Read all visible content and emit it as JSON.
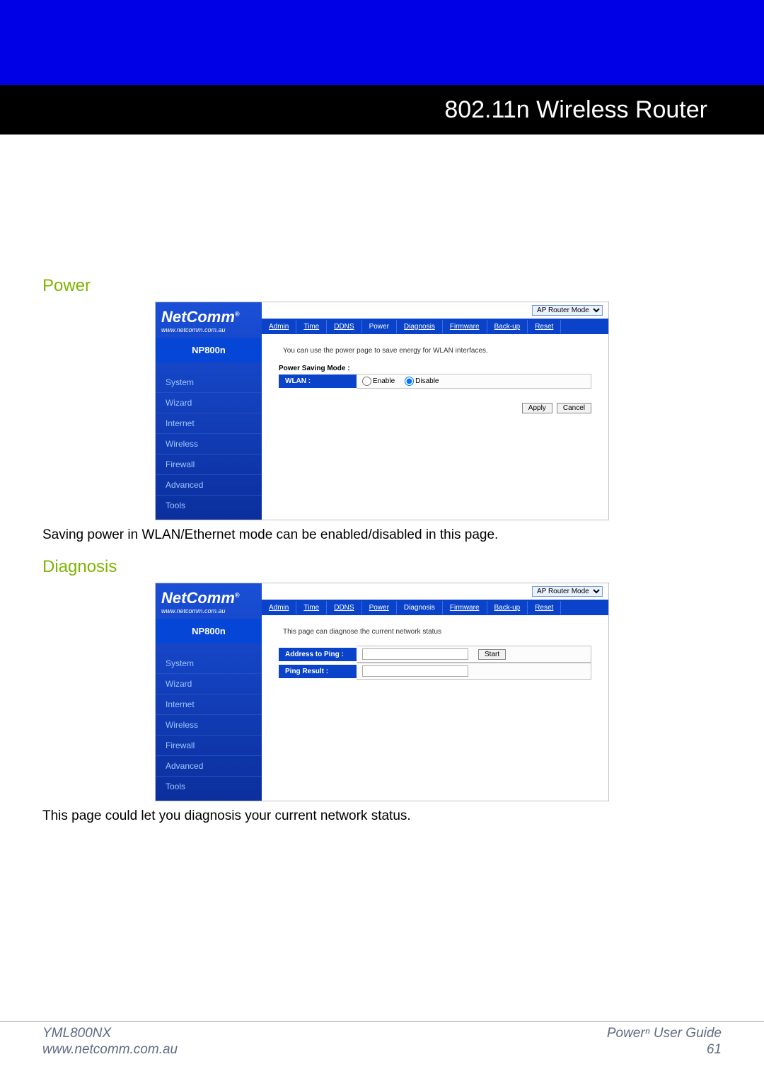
{
  "header": {
    "product_title": "802.11n Wireless Router"
  },
  "sections": {
    "power": {
      "heading": "Power",
      "caption": "Saving power in WLAN/Ethernet mode can be enabled/disabled in this page."
    },
    "diagnosis": {
      "heading": "Diagnosis",
      "caption": "This page could let you diagnosis your current network status."
    }
  },
  "router_ui": {
    "logo": "NetComm",
    "logo_reg": "®",
    "logo_url": "www.netcomm.com.au",
    "model": "NP800n",
    "mode_label": "AP Router Mode",
    "sidebar_items": [
      "System",
      "Wizard",
      "Internet",
      "Wireless",
      "Firewall",
      "Advanced",
      "Tools"
    ],
    "tabs": [
      "Admin",
      "Time",
      "DDNS",
      "Power",
      "Diagnosis",
      "Firmware",
      "Back-up",
      "Reset"
    ],
    "power_panel": {
      "description": "You can use the power page to save energy for WLAN interfaces.",
      "group_title": "Power Saving Mode :",
      "row_label": "WLAN :",
      "opt_enable": "Enable",
      "opt_disable": "Disable",
      "btn_apply": "Apply",
      "btn_cancel": "Cancel"
    },
    "diag_panel": {
      "description": "This page can diagnose the current network status",
      "row_addr_label": "Address to Ping :",
      "row_result_label": "Ping Result :",
      "btn_start": "Start"
    }
  },
  "footer": {
    "left_line1": "YML800NX",
    "left_line2": "www.netcomm.com.au",
    "right_line1": "Powerⁿ User Guide",
    "right_line2": "61"
  }
}
